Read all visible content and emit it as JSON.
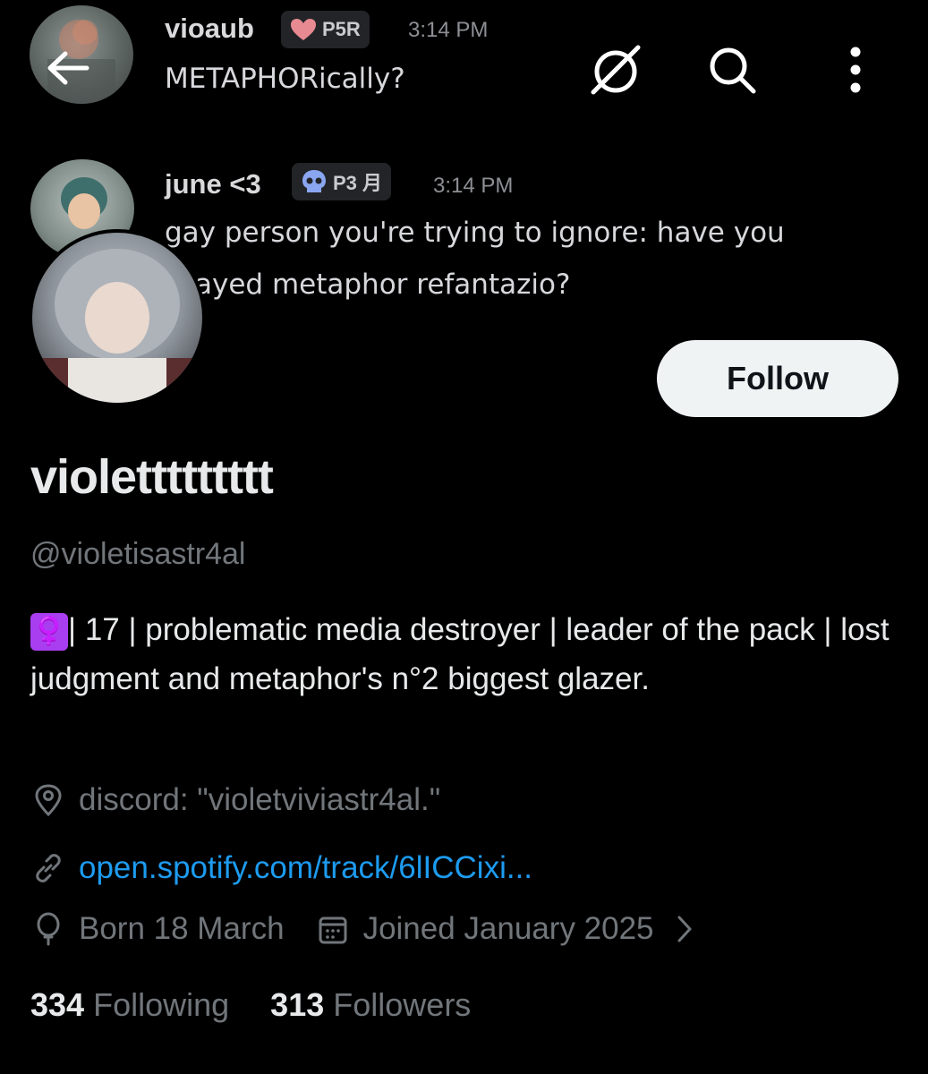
{
  "messages": [
    {
      "author": "vioaub",
      "tag": "P5R",
      "time": "3:14 PM",
      "text": "METAPHORically?"
    },
    {
      "author": "june <3",
      "tag": "P3 月",
      "time": "3:14 PM",
      "text_line1": "gay person you're trying to ignore: have you",
      "text_line2": "ayed metaphor refantazio?"
    }
  ],
  "header": {
    "back_icon": "arrow-left-icon",
    "grok_icon": "slash-circle-icon",
    "search_icon": "search-icon",
    "more_icon": "more-vertical-icon"
  },
  "profile": {
    "follow_label": "Follow",
    "display_name": "violettttttttt",
    "handle": "@violetisastr4al",
    "bio_emoji": "♀️",
    "bio": "| 17 | problematic media destroyer | leader of the pack | lost judgment and metaphor's n°2 biggest glazer.",
    "location": "discord: \"violetviviastr4al.\"",
    "link": "open.spotify.com/track/6lICCixi...",
    "birthday": "Born 18 March",
    "joined": "Joined January 2025",
    "following_count": "334",
    "following_label": "Following",
    "followers_count": "313",
    "followers_label": "Followers"
  },
  "colors": {
    "background": "#000000",
    "link": "#1d9bf0",
    "muted": "#71767b",
    "emoji_bg": "#a93ef0"
  }
}
